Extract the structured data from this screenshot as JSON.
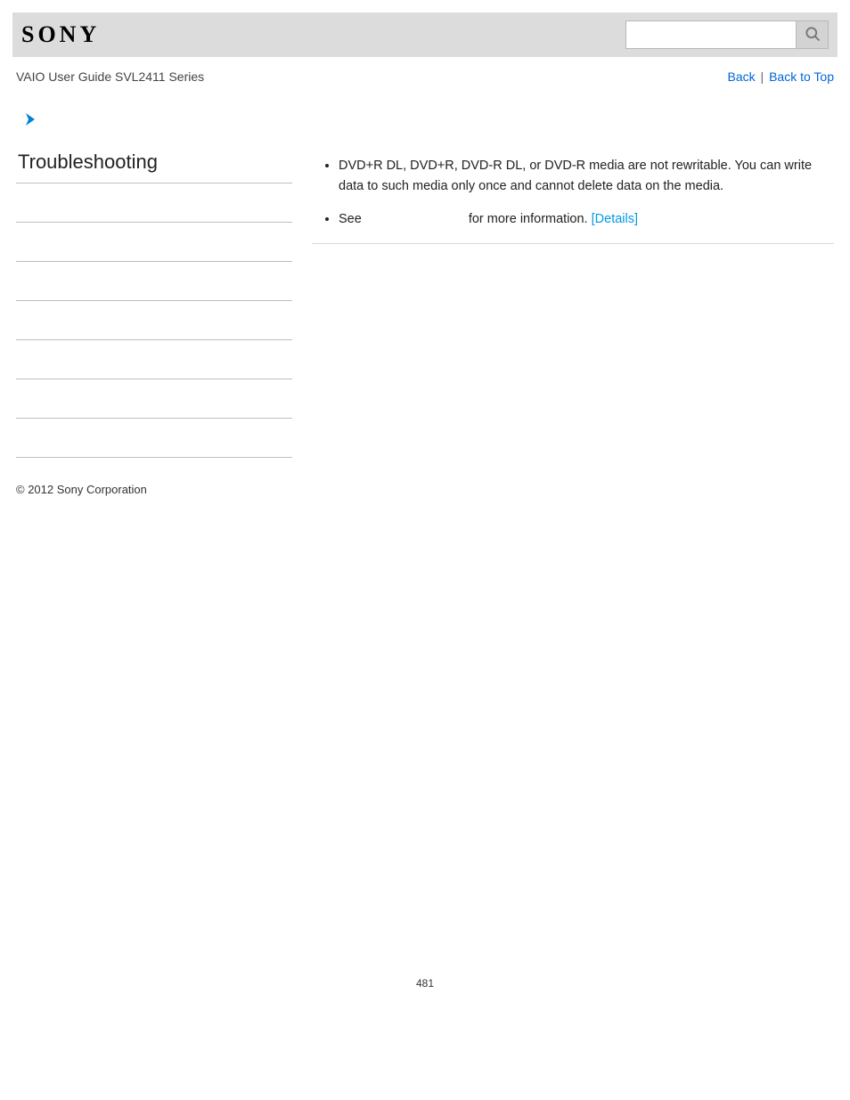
{
  "header": {
    "logo_text": "SONY",
    "search_placeholder": ""
  },
  "subheader": {
    "guide_title": "VAIO User Guide SVL2411 Series",
    "back_label": "Back",
    "separator": " | ",
    "back_to_top_label": "Back to Top"
  },
  "sidebar": {
    "heading": "Troubleshooting",
    "items": [
      "",
      "",
      "",
      "",
      "",
      "",
      ""
    ]
  },
  "content": {
    "bullet1": "DVD+R DL, DVD+R, DVD-R DL, or DVD-R media are not rewritable. You can write data to such media only once and cannot delete data on the media.",
    "bullet2_pre": "See",
    "bullet2_post": "for more information. ",
    "bullet2_link": "[Details]"
  },
  "footer": {
    "copyright": "© 2012 Sony Corporation",
    "page_number": "481"
  },
  "colors": {
    "link_blue": "#0066d6",
    "link_cyan": "#0099e6",
    "header_bg": "#dcdcdc"
  }
}
